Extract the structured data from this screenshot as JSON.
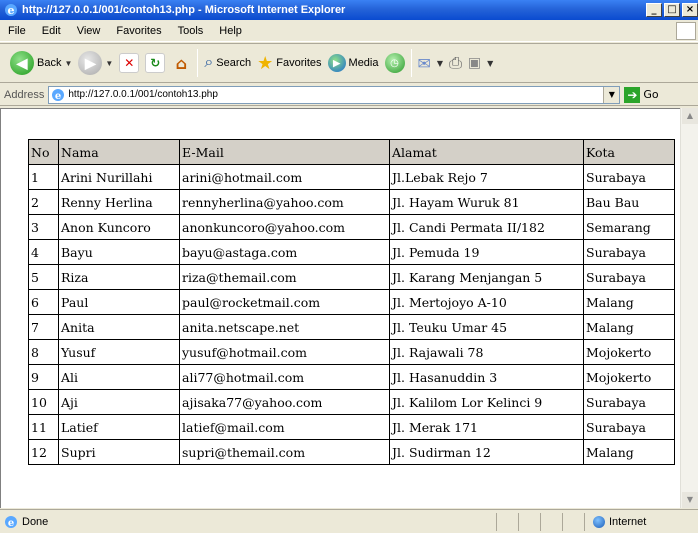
{
  "window": {
    "title": "http://127.0.0.1/001/contoh13.php - Microsoft Internet Explorer",
    "minimize": "_",
    "maximize": "□",
    "close": "×"
  },
  "menu": [
    "File",
    "Edit",
    "View",
    "Favorites",
    "Tools",
    "Help"
  ],
  "toolbar": {
    "back_label": "Back",
    "search_label": "Search",
    "favorites_label": "Favorites",
    "media_label": "Media"
  },
  "address": {
    "label": "Address",
    "url": "http://127.0.0.1/001/contoh13.php",
    "go_label": "Go"
  },
  "table": {
    "headers": [
      "No",
      "Nama",
      "E-Mail",
      "Alamat",
      "Kota"
    ],
    "rows": [
      [
        "1",
        "Arini Nurillahi",
        "arini@hotmail.com",
        "Jl.Lebak Rejo 7",
        "Surabaya"
      ],
      [
        "2",
        "Renny Herlina",
        "rennyherlina@yahoo.com",
        "Jl. Hayam Wuruk 81",
        "Bau Bau"
      ],
      [
        "3",
        "Anon Kuncoro",
        "anonkuncoro@yahoo.com",
        "Jl. Candi Permata II/182",
        "Semarang"
      ],
      [
        "4",
        "Bayu",
        "bayu@astaga.com",
        "Jl. Pemuda 19",
        "Surabaya"
      ],
      [
        "5",
        "Riza",
        "riza@themail.com",
        "Jl. Karang Menjangan 5",
        "Surabaya"
      ],
      [
        "6",
        "Paul",
        "paul@rocketmail.com",
        "Jl. Mertojoyo A-10",
        "Malang"
      ],
      [
        "7",
        "Anita",
        "anita.netscape.net",
        "Jl. Teuku Umar 45",
        "Malang"
      ],
      [
        "8",
        "Yusuf",
        "yusuf@hotmail.com",
        "Jl. Rajawali 78",
        "Mojokerto"
      ],
      [
        "9",
        "Ali",
        "ali77@hotmail.com",
        "Jl. Hasanuddin 3",
        "Mojokerto"
      ],
      [
        "10",
        "Aji",
        "ajisaka77@yahoo.com",
        "Jl. Kalilom Lor Kelinci 9",
        "Surabaya"
      ],
      [
        "11",
        "Latief",
        "latief@mail.com",
        "Jl. Merak 171",
        "Surabaya"
      ],
      [
        "12",
        "Supri",
        "supri@themail.com",
        "Jl. Sudirman 12",
        "Malang"
      ]
    ]
  },
  "status": {
    "text": "Done",
    "zone": "Internet"
  }
}
